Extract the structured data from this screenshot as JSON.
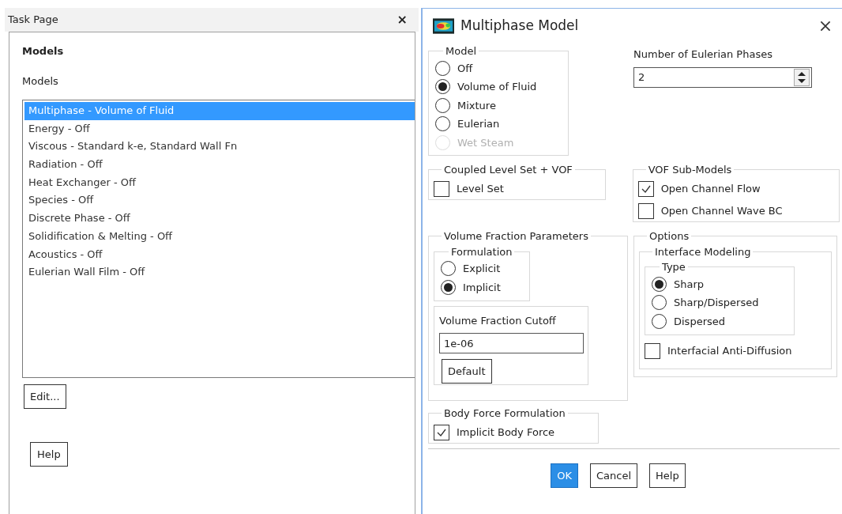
{
  "task_page": {
    "title": "Task Page",
    "close": "×",
    "heading": "Models",
    "list_label": "Models",
    "models": [
      {
        "label": "Multiphase - Volume of Fluid",
        "selected": true
      },
      {
        "label": "Energy - Off",
        "selected": false
      },
      {
        "label": "Viscous - Standard k-e, Standard Wall Fn",
        "selected": false
      },
      {
        "label": "Radiation - Off",
        "selected": false
      },
      {
        "label": "Heat Exchanger - Off",
        "selected": false
      },
      {
        "label": "Species - Off",
        "selected": false
      },
      {
        "label": "Discrete Phase - Off",
        "selected": false
      },
      {
        "label": "Solidification & Melting - Off",
        "selected": false
      },
      {
        "label": "Acoustics - Off",
        "selected": false
      },
      {
        "label": "Eulerian Wall Film - Off",
        "selected": false
      }
    ],
    "edit_button": "Edit...",
    "help_button": "Help"
  },
  "dialog": {
    "title": "Multiphase Model",
    "model": {
      "title": "Model",
      "options": [
        {
          "label": "Off",
          "selected": false,
          "disabled": false
        },
        {
          "label": "Volume of Fluid",
          "selected": true,
          "disabled": false
        },
        {
          "label": "Mixture",
          "selected": false,
          "disabled": false
        },
        {
          "label": "Eulerian",
          "selected": false,
          "disabled": false
        },
        {
          "label": "Wet Steam",
          "selected": false,
          "disabled": true
        }
      ]
    },
    "phases": {
      "label": "Number of Eulerian Phases",
      "value": "2"
    },
    "coupled": {
      "title": "Coupled Level Set + VOF",
      "options": [
        {
          "label": "Level Set",
          "checked": false
        }
      ]
    },
    "vof_submodels": {
      "title": "VOF Sub-Models",
      "options": [
        {
          "label": "Open Channel Flow",
          "checked": true
        },
        {
          "label": "Open Channel Wave BC",
          "checked": false
        }
      ]
    },
    "volume_fraction": {
      "title": "Volume Fraction Parameters",
      "formulation": {
        "title": "Formulation",
        "options": [
          {
            "label": "Explicit",
            "selected": false
          },
          {
            "label": "Implicit",
            "selected": true
          }
        ]
      },
      "cutoff": {
        "title": "Volume Fraction Cutoff",
        "value": "1e-06",
        "button": "Default"
      }
    },
    "options": {
      "title": "Options",
      "interface": {
        "title": "Interface Modeling",
        "type": {
          "title": "Type",
          "options": [
            {
              "label": "Sharp",
              "selected": true
            },
            {
              "label": "Sharp/Dispersed",
              "selected": false
            },
            {
              "label": "Dispersed",
              "selected": false
            }
          ]
        },
        "checkboxes": [
          {
            "label": "Interfacial Anti-Diffusion",
            "checked": false
          }
        ]
      }
    },
    "body_force": {
      "title": "Body Force Formulation",
      "options": [
        {
          "label": "Implicit Body Force",
          "checked": true
        }
      ]
    },
    "buttons": [
      {
        "label": "OK",
        "default": true
      },
      {
        "label": "Cancel",
        "default": false
      },
      {
        "label": "Help",
        "default": false
      }
    ]
  }
}
